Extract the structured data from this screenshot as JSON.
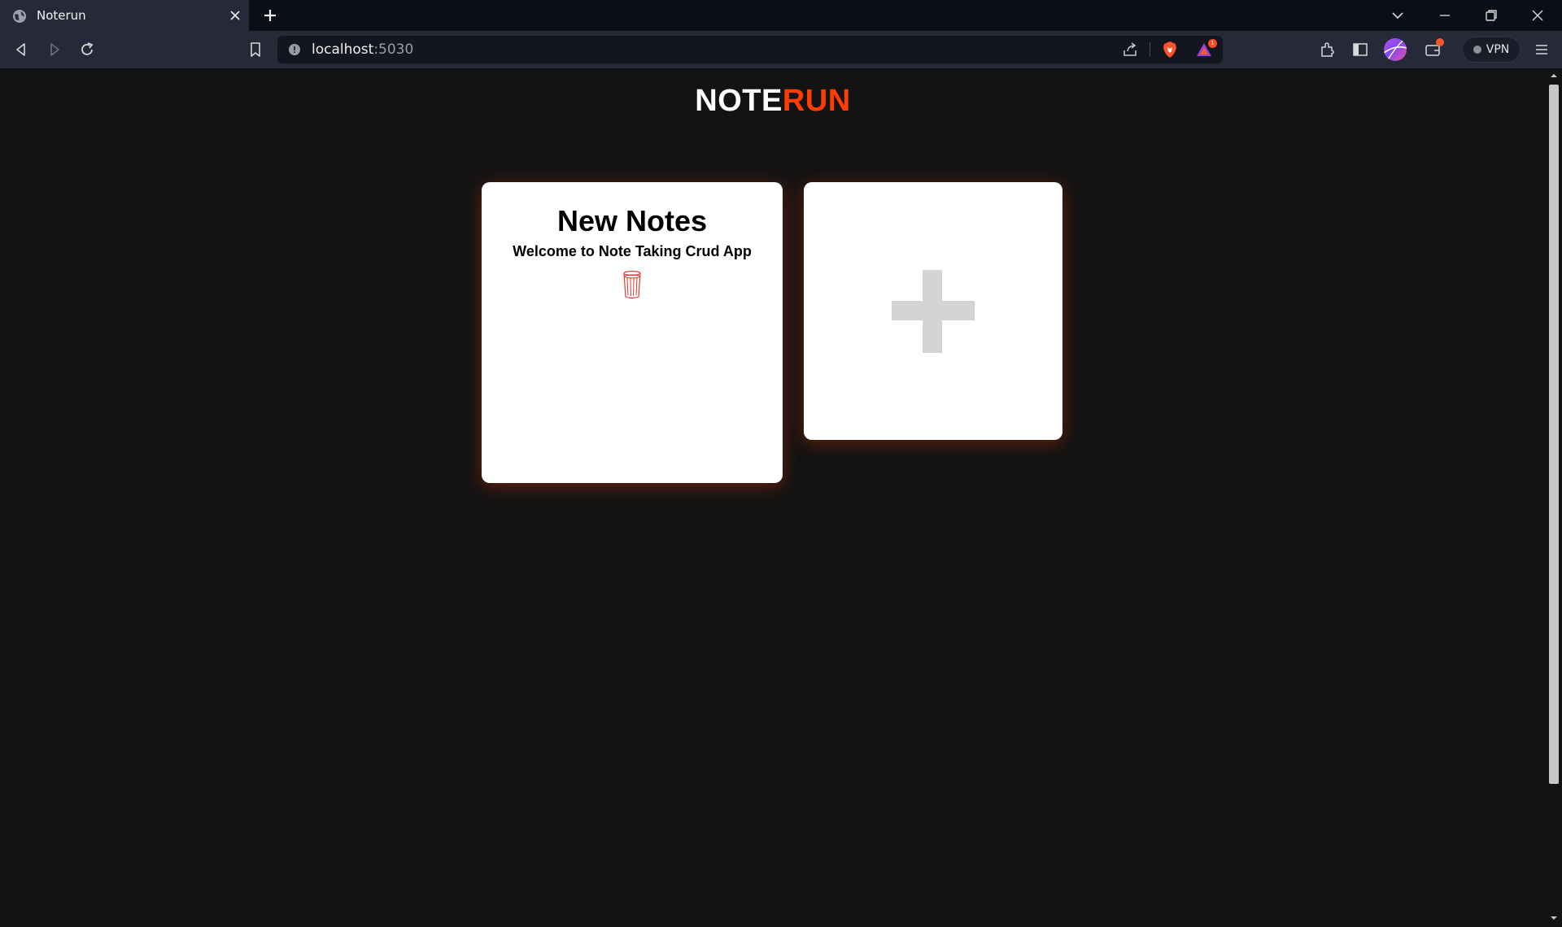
{
  "browser": {
    "tab": {
      "title": "Noterun"
    },
    "url": {
      "host": "localhost",
      "port": ":5030"
    },
    "vpn_label": "VPN",
    "rewards_badge": "1"
  },
  "app": {
    "logo": {
      "part1": "NOTE",
      "part2": "RUN"
    },
    "notes": [
      {
        "title": "New Notes",
        "body": "Welcome to Note Taking Crud App"
      }
    ]
  },
  "colors": {
    "background": "#131313",
    "card": "#ffffff",
    "accent": "#ff3d00",
    "plus": "#d4d4d4",
    "trash": "#e53935"
  },
  "icons": {
    "delete": "trash-icon",
    "add": "plus-icon"
  }
}
